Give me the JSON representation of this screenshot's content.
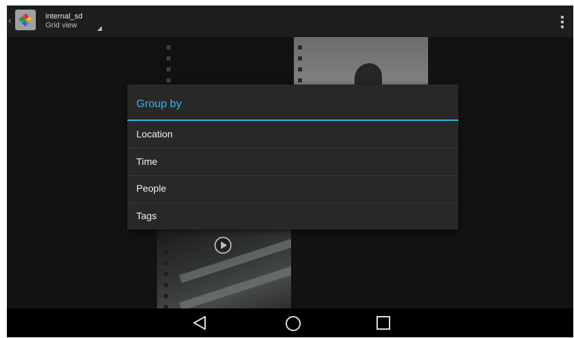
{
  "action_bar": {
    "title": "internal_sd",
    "subtitle": "Grid view",
    "icons": [
      "back-arrow-icon",
      "photos-pinwheel-icon",
      "dropdown-triangle-icon",
      "overflow-menu-icon"
    ]
  },
  "thumbnails": {
    "icons": [
      "play-icon"
    ]
  },
  "dialog": {
    "title": "Group by",
    "options": [
      "Location",
      "Time",
      "People",
      "Tags"
    ],
    "accent_color": "#33b5e5"
  },
  "nav_bar": {
    "buttons": [
      "back-icon",
      "home-icon",
      "recents-icon"
    ]
  }
}
